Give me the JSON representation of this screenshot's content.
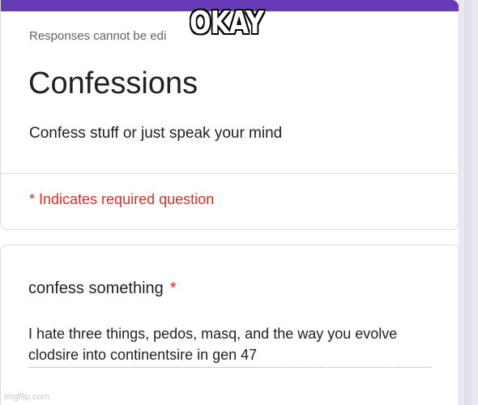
{
  "form": {
    "accent_color": "#673ab7",
    "no_edit_notice": "Responses cannot be edi",
    "title": "Confessions",
    "description": "Confess stuff or just speak your mind",
    "required_note": "* Indicates required question"
  },
  "question": {
    "title": "confess something",
    "required_marker": "*",
    "answer": "I hate three things, pedos, masq, and the way you evolve clodsire into continentsire in gen 47"
  },
  "overlay": {
    "caption": "OKAY",
    "watermark": "imgflip.com"
  }
}
